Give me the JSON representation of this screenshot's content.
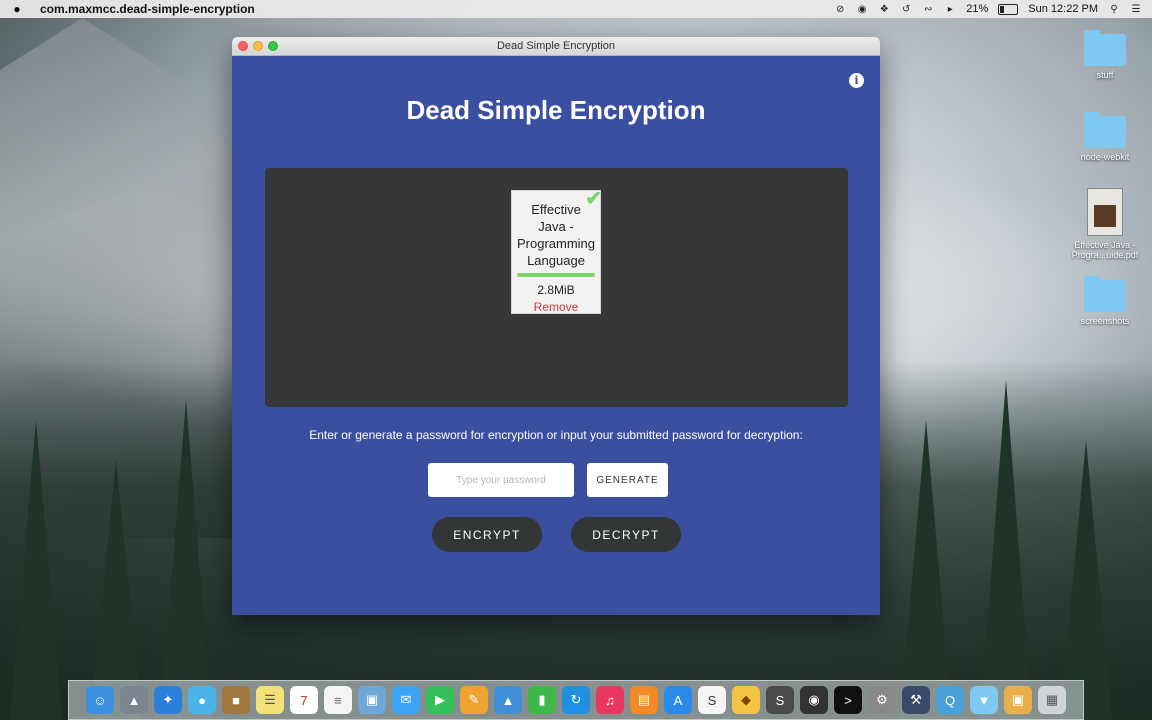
{
  "menubar": {
    "app_name": "com.maxmcc.dead-simple-encryption",
    "battery_percent": "21%",
    "clock": "Sun 12:22 PM"
  },
  "window": {
    "title": "Dead Simple Encryption"
  },
  "app": {
    "title": "Dead Simple Encryption",
    "file": {
      "name": "Effective Java - Programming Language",
      "size": "2.8MiB",
      "remove_label": "Remove",
      "progress": 1.0
    },
    "instructions": "Enter or generate a password for encryption or input your submitted password for decryption:",
    "password_placeholder": "Type your password",
    "password_value": "",
    "generate_label": "GENERATE",
    "encrypt_label": "ENCRYPT",
    "decrypt_label": "DECRYPT"
  },
  "desktop": {
    "items": [
      {
        "label": "stuff",
        "kind": "folder"
      },
      {
        "label": "node-webkit",
        "kind": "folder"
      },
      {
        "label": "Effective Java - Progra...uide.pdf",
        "kind": "pdf"
      },
      {
        "label": "screenshots",
        "kind": "folder"
      }
    ]
  },
  "dock": {
    "icons": [
      "finder-icon",
      "launchpad-icon",
      "safari-icon",
      "photo-browser-icon",
      "contacts-icon",
      "notes-icon",
      "calendar-icon",
      "reminders-icon",
      "preview-icon",
      "messages-icon",
      "facetime-icon",
      "pages-icon",
      "keynote-icon",
      "numbers-icon",
      "sync-icon",
      "itunes-icon",
      "ibooks-icon",
      "app-store-icon",
      "skype-icon",
      "sketch-icon",
      "sublime-icon",
      "chrome-icon",
      "terminal-icon",
      "system-preferences-icon",
      "xcode-icon",
      "quicktime-icon",
      "downloads-folder-icon",
      "archive-icon",
      "trash-icon"
    ]
  },
  "colors": {
    "window_bg": "#3b4fa0",
    "dropzone_bg": "#343638",
    "button_dark": "#333637",
    "remove_red": "#d0393b",
    "progress_green": "#7ed36b"
  }
}
